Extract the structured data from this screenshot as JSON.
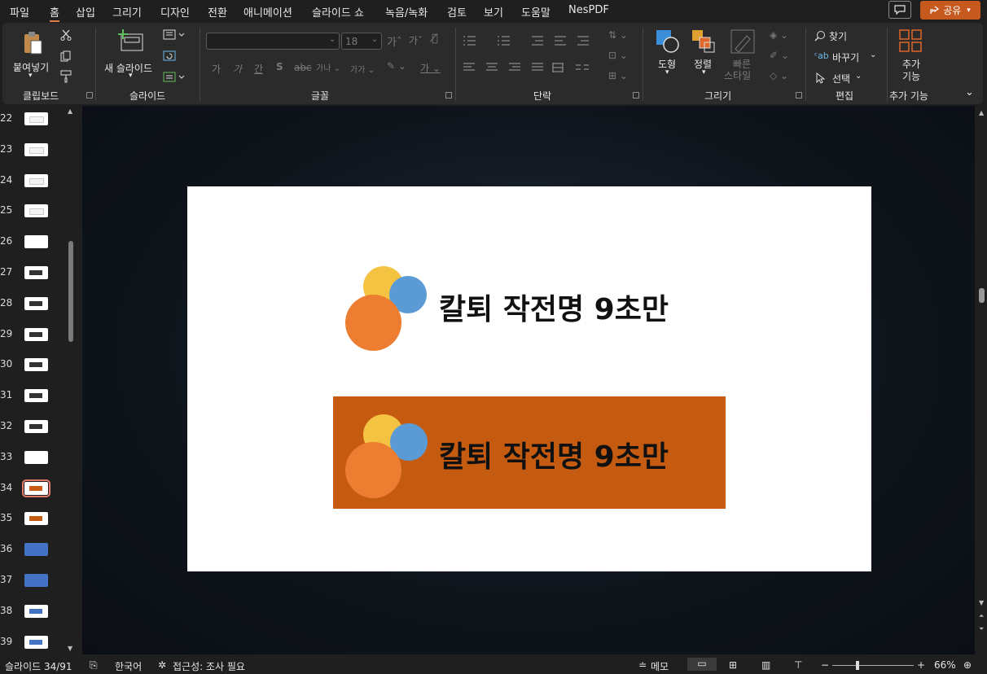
{
  "menu": [
    "파일",
    "홈",
    "삽입",
    "그리기",
    "디자인",
    "전환",
    "애니메이션",
    "슬라이드 쇼",
    "녹음/녹화",
    "검토",
    "보기",
    "도움말",
    "NesPDF"
  ],
  "share_label": "공유",
  "ribbon": {
    "clipboard": {
      "group": "클립보드",
      "paste": "붙여넣기"
    },
    "slides": {
      "group": "슬라이드",
      "new_slide": "새 슬라이드"
    },
    "font": {
      "group": "글꼴",
      "font_name": "",
      "font_size": "18"
    },
    "paragraph": {
      "group": "단락"
    },
    "drawing": {
      "group": "그리기",
      "shapes": "도형",
      "arrange": "정렬",
      "quick_styles_1": "빠른",
      "quick_styles_2": "스타일"
    },
    "editing": {
      "group": "편집",
      "find": "찾기",
      "replace": "바꾸기",
      "select": "선택"
    },
    "addins": {
      "group": "추가 기능",
      "label_1": "추가",
      "label_2": "기능"
    }
  },
  "thumbnails": [
    "22",
    "23",
    "24",
    "25",
    "26",
    "27",
    "28",
    "29",
    "30",
    "31",
    "32",
    "33",
    "34",
    "35",
    "36",
    "37",
    "38",
    "39"
  ],
  "selected_slide": "34",
  "slide": {
    "logo_text_1": "칼퇴 작전명 9초만",
    "logo_text_2": "칼퇴 작전명 9초만"
  },
  "colors": {
    "accent": "#e07b4b",
    "banner": "#c55a11",
    "yellow": "#f5c342",
    "blue": "#5b9bd5",
    "orange": "#ed7d31"
  },
  "status": {
    "slide_info": "슬라이드 34/91",
    "language": "한국어",
    "accessibility": "접근성: 조사 필요",
    "notes": "메모",
    "zoom": "66%"
  }
}
